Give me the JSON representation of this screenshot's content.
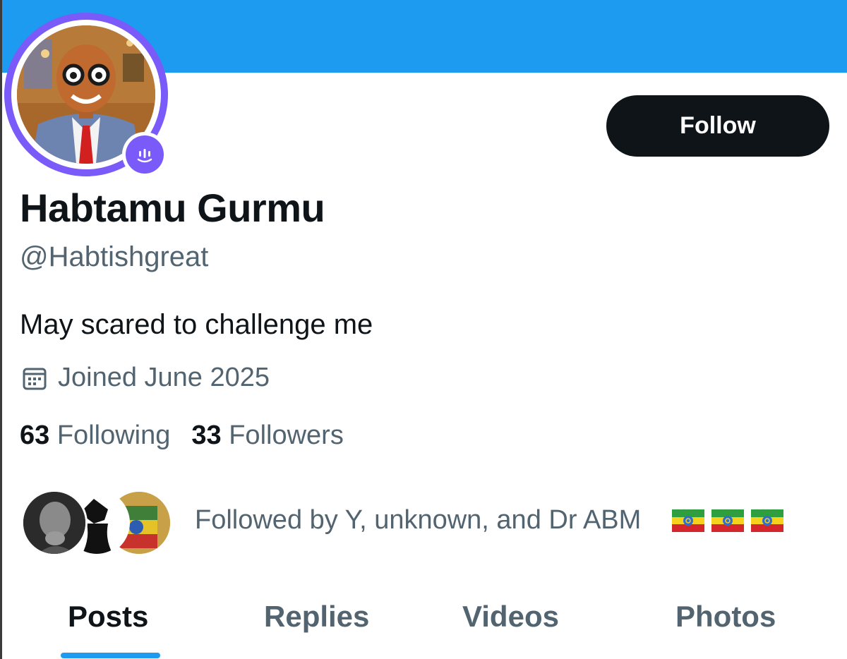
{
  "profile": {
    "display_name": "Habtamu Gurmu",
    "handle": "@Habtishgreat",
    "bio": "May scared to challenge me",
    "joined": "Joined June 2025",
    "following_count": "63",
    "following_label": "Following",
    "followers_count": "33",
    "followers_label": "Followers"
  },
  "actions": {
    "follow_label": "Follow"
  },
  "followed_by": {
    "text": "Followed by Y, unknown, and Dr ABM"
  },
  "tabs": [
    {
      "label": "Posts",
      "active": true
    },
    {
      "label": "Replies",
      "active": false
    },
    {
      "label": "Videos",
      "active": false
    },
    {
      "label": "Photos",
      "active": false
    }
  ],
  "icons": {
    "calendar": "calendar-icon",
    "spaces": "spaces-microphone-icon",
    "flag": "ethiopia-flag-icon"
  },
  "colors": {
    "banner": "#1d9bf0",
    "accent_purple": "#7a5af8",
    "text_primary": "#0f1419",
    "text_secondary": "#536471",
    "follow_button": "#0f1419"
  }
}
